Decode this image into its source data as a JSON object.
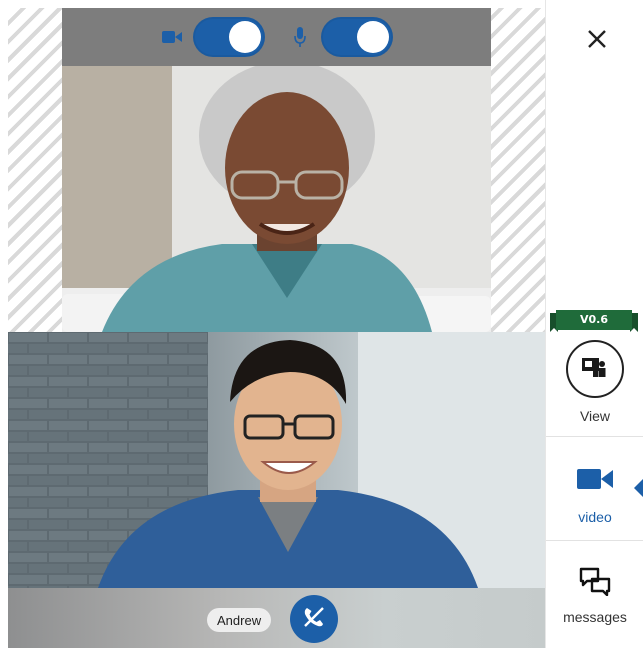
{
  "remote_video": {
    "camera_toggle": {
      "icon": "video-camera-icon",
      "on": true
    },
    "mic_toggle": {
      "icon": "microphone-icon",
      "on": true
    }
  },
  "local_video": {
    "participant_name": "Andrew",
    "hangup_icon": "hangup-phone-icon"
  },
  "sidebar": {
    "close_icon": "close-icon",
    "version": "V0.6",
    "items": [
      {
        "label": "View",
        "icon": "view-layout-icon"
      },
      {
        "label": "video",
        "icon": "video-camera-icon",
        "active": true
      },
      {
        "label": "messages",
        "icon": "messages-icon"
      }
    ]
  },
  "colors": {
    "accent": "#1c5fa8",
    "toolbar": "#7d7d7d",
    "version_ribbon": "#1f6b3a"
  }
}
